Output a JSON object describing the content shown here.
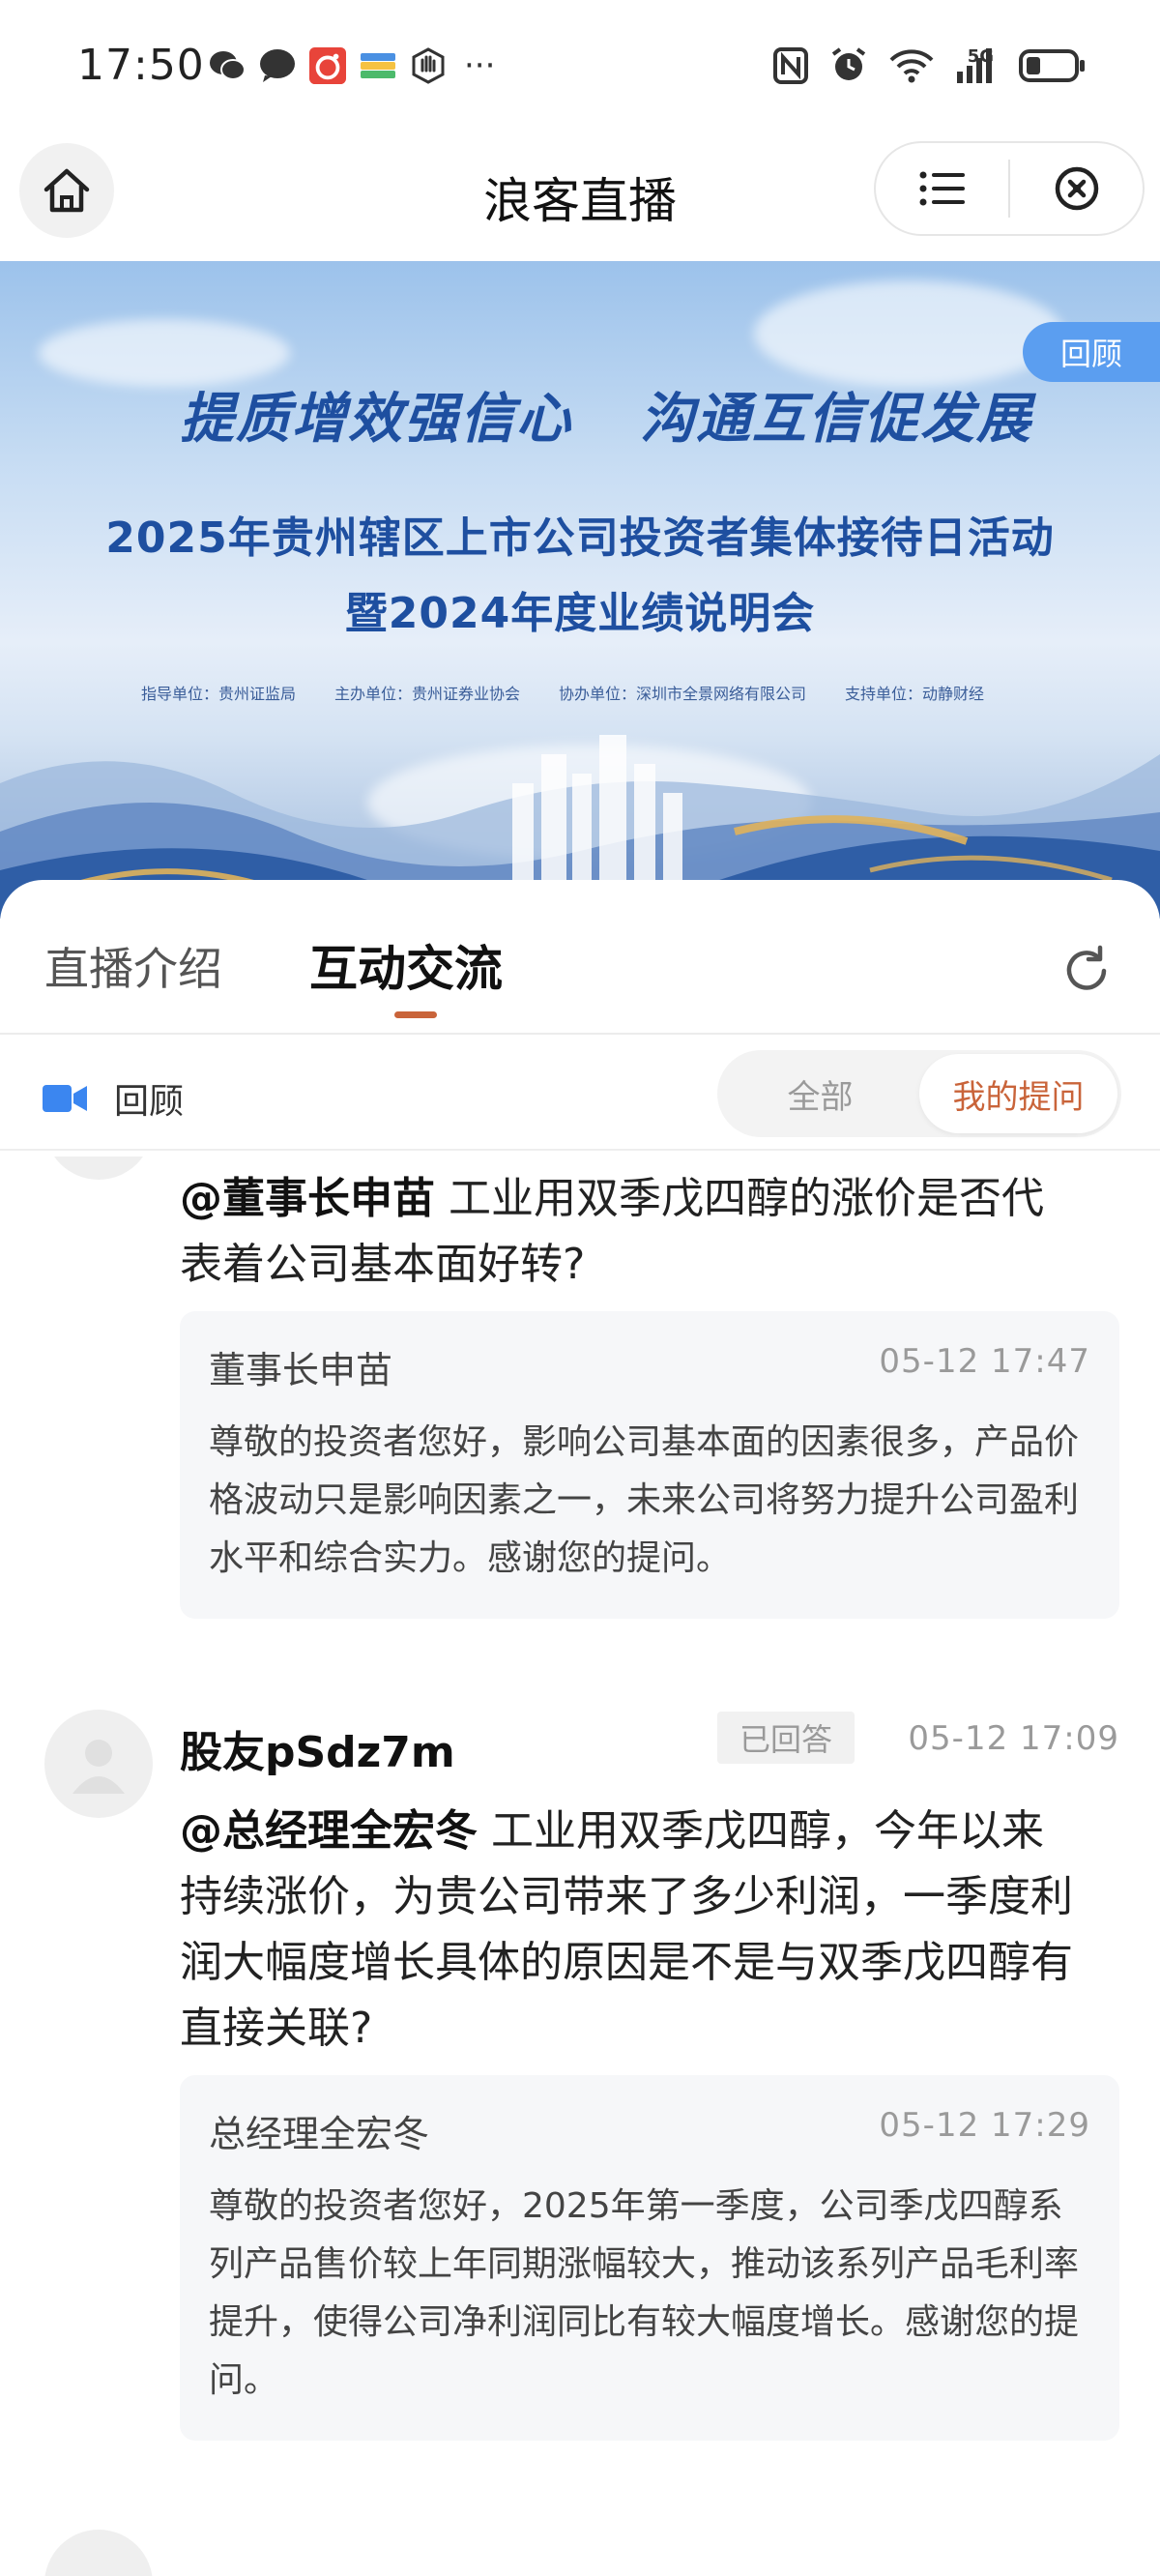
{
  "status_bar": {
    "time": "17:50",
    "network": "5G",
    "left_icons": [
      "wechat-icon",
      "message-icon",
      "camera-app-icon",
      "wallet-icon",
      "hand-icon"
    ],
    "right_icons": [
      "nfc-icon",
      "alarm-icon",
      "wifi-icon",
      "signal-icon",
      "battery-icon"
    ]
  },
  "nav": {
    "title": "浪客直播",
    "home_icon": "home-icon",
    "menu_icon": "list-icon",
    "close_icon": "close-circle-icon"
  },
  "banner": {
    "tag": "回顾",
    "headline_left": "提质增效强信心",
    "headline_right": "沟通互信促发展",
    "title_line1": "2025年贵州辖区上市公司投资者集体接待日活动",
    "title_line2": "暨2024年度业绩说明会",
    "meta": [
      "指导单位：贵州证监局",
      "主办单位：贵州证券业协会",
      "协办单位：深圳市全景网络有限公司",
      "支持单位：动静财经"
    ]
  },
  "tabs": {
    "intro": "直播介绍",
    "chat": "互动交流",
    "active": "chat"
  },
  "filter": {
    "replay_label": "回顾",
    "options": [
      "全部",
      "我的提问"
    ],
    "selected": "我的提问"
  },
  "feed": [
    {
      "mention": "@董事长申苗",
      "question": "工业用双季戊四醇的涨价是否代表着公司基本面好转?",
      "reply": {
        "name": "董事长申苗",
        "time": "05-12 17:47",
        "body": "尊敬的投资者您好，影响公司基本面的因素很多，产品价格波动只是影响因素之一，未来公司将努力提升公司盈利水平和综合实力。感谢您的提问。"
      }
    },
    {
      "user": "股友pSdz7m",
      "badge": "已回答",
      "time": "05-12 17:09",
      "mention": "@总经理全宏冬",
      "question": "工业用双季戊四醇，今年以来持续涨价，为贵公司带来了多少利润，一季度利润大幅度增长具体的原因是不是与双季戊四醇有直接关联?",
      "reply": {
        "name": "总经理全宏冬",
        "time": "05-12 17:29",
        "body": "尊敬的投资者您好，2025年第一季度，公司季戊四醇系列产品售价较上年同期涨幅较大，推动该系列产品毛利率提升，使得公司净利润同比有较大幅度增长。感谢您的提问。"
      }
    }
  ]
}
